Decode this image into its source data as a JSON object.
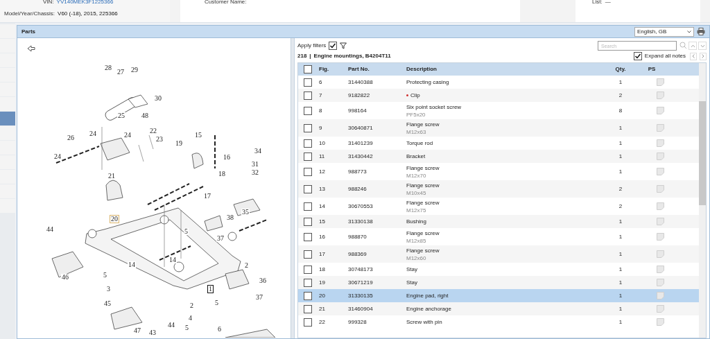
{
  "header": {
    "vin_label": "VIN:",
    "vin": "YV140MEK3F1225366",
    "model_label": "Model/Year/Chassis:",
    "model": "V60 (-18), 2015, 225366",
    "customer_label": "Customer Name:",
    "list_label": "List:",
    "list_value": "—"
  },
  "sidebar": {
    "items": [
      {
        "selected": false
      },
      {
        "selected": false
      },
      {
        "selected": false
      },
      {
        "selected": false
      },
      {
        "selected": false
      },
      {
        "selected": false
      },
      {
        "selected": true
      },
      {
        "selected": false
      },
      {
        "selected": false
      },
      {
        "selected": false
      },
      {
        "selected": false
      },
      {
        "selected": false
      },
      {
        "selected": false
      }
    ]
  },
  "panel": {
    "title": "Parts",
    "language": "English, GB"
  },
  "diagram": {
    "callouts": [
      {
        "label": "28"
      },
      {
        "label": "27"
      },
      {
        "label": "29"
      },
      {
        "label": "30"
      },
      {
        "label": "25"
      },
      {
        "label": "48"
      },
      {
        "label": "24"
      },
      {
        "label": "22"
      },
      {
        "label": "24"
      },
      {
        "label": "26"
      },
      {
        "label": "23"
      },
      {
        "label": "24"
      },
      {
        "label": "21"
      },
      {
        "label": "19"
      },
      {
        "label": "15"
      },
      {
        "label": "16"
      },
      {
        "label": "18"
      },
      {
        "label": "34"
      },
      {
        "label": "31"
      },
      {
        "label": "32"
      },
      {
        "label": "17"
      },
      {
        "label": "35"
      },
      {
        "label": "20",
        "boxed": true
      },
      {
        "label": "38"
      },
      {
        "label": "44"
      },
      {
        "label": "5"
      },
      {
        "label": "37"
      },
      {
        "label": "14"
      },
      {
        "label": "14"
      },
      {
        "label": "2"
      },
      {
        "label": "46"
      },
      {
        "label": "5"
      },
      {
        "label": "36"
      },
      {
        "label": "1",
        "boxed": true
      },
      {
        "label": "3"
      },
      {
        "label": "37"
      },
      {
        "label": "45"
      },
      {
        "label": "5"
      },
      {
        "label": "2"
      },
      {
        "label": "4"
      },
      {
        "label": "44"
      },
      {
        "label": "5"
      },
      {
        "label": "47"
      },
      {
        "label": "43"
      },
      {
        "label": "6"
      }
    ]
  },
  "filters": {
    "label": "Apply filters",
    "checked": true
  },
  "search": {
    "placeholder": "Search"
  },
  "group": {
    "number": "218",
    "separator": "|",
    "title": "Engine mountings, B4204T11"
  },
  "expand_notes": {
    "label": "Expand all notes",
    "checked": true
  },
  "table": {
    "select_all_checked": false,
    "columns": [
      "Fig.",
      "Part No.",
      "Description",
      "Qty.",
      "PS"
    ],
    "rows": [
      {
        "fig": "6",
        "part_no": "31440388",
        "description": "Protecting casing",
        "qty": "1",
        "selected": false,
        "flagged": false
      },
      {
        "fig": "7",
        "part_no": "9182822",
        "description": "Clip",
        "qty": "2",
        "selected": false,
        "flagged": true
      },
      {
        "fig": "8",
        "part_no": "998164",
        "description": "Six point socket screw",
        "note": "PF5x20",
        "qty": "8",
        "selected": false,
        "flagged": false
      },
      {
        "fig": "9",
        "part_no": "30640871",
        "description": "Flange screw",
        "note": "M12x63",
        "qty": "1",
        "selected": false,
        "flagged": false
      },
      {
        "fig": "10",
        "part_no": "31401239",
        "description": "Torque rod",
        "qty": "1",
        "selected": false,
        "flagged": false
      },
      {
        "fig": "11",
        "part_no": "31430442",
        "description": "Bracket",
        "qty": "1",
        "selected": false,
        "flagged": false
      },
      {
        "fig": "12",
        "part_no": "988773",
        "description": "Flange screw",
        "note": "M12x70",
        "qty": "1",
        "selected": false,
        "flagged": false
      },
      {
        "fig": "13",
        "part_no": "988246",
        "description": "Flange screw",
        "note": "M10x45",
        "qty": "2",
        "selected": false,
        "flagged": false
      },
      {
        "fig": "14",
        "part_no": "30670553",
        "description": "Flange screw",
        "note": "M12x75",
        "qty": "2",
        "selected": false,
        "flagged": false
      },
      {
        "fig": "15",
        "part_no": "31330138",
        "description": "Bushing",
        "qty": "1",
        "selected": false,
        "flagged": false
      },
      {
        "fig": "16",
        "part_no": "988870",
        "description": "Flange screw",
        "note": "M12x85",
        "qty": "1",
        "selected": false,
        "flagged": false
      },
      {
        "fig": "17",
        "part_no": "988369",
        "description": "Flange screw",
        "note": "M12x60",
        "qty": "1",
        "selected": false,
        "flagged": false
      },
      {
        "fig": "18",
        "part_no": "30748173",
        "description": "Stay",
        "qty": "1",
        "selected": false,
        "flagged": false
      },
      {
        "fig": "19",
        "part_no": "30671219",
        "description": "Stay",
        "qty": "1",
        "selected": false,
        "flagged": false
      },
      {
        "fig": "20",
        "part_no": "31330135",
        "description": "Engine pad, right",
        "qty": "1",
        "selected": true,
        "flagged": false
      },
      {
        "fig": "21",
        "part_no": "31460904",
        "description": "Engine anchorage",
        "qty": "1",
        "selected": false,
        "flagged": false
      },
      {
        "fig": "22",
        "part_no": "999328",
        "description": "Screw with pin",
        "qty": "1",
        "selected": false,
        "flagged": false
      }
    ]
  }
}
